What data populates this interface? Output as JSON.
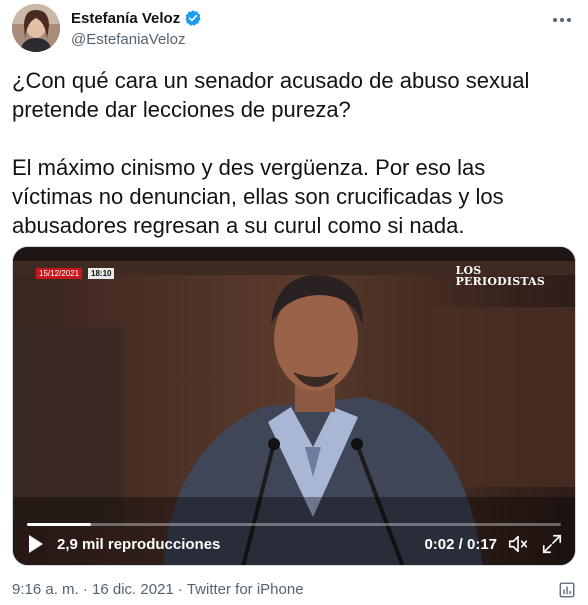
{
  "author": {
    "display_name": "Estefanía Veloz",
    "handle": "@EstefaniaVeloz",
    "avatar_icon": "avatar-photo",
    "verified_icon": "verified-badge-icon"
  },
  "tweet": {
    "text": "¿Con qué cara un senador acusado de abuso sexual\npretende dar lecciones de pureza?\n\nEl máximo cinismo y des vergüenza. Por eso las\nvíctimas no denuncian, ellas son crucificadas y los\nabusadores regresan a su curul como si nada."
  },
  "video": {
    "stamp_date": "15/12/2021",
    "stamp_time": "18:10",
    "logo_line1": "LOS",
    "logo_line2": "PERIODISTAS",
    "views": "2,9 mil reproducciones",
    "time": "0:02 / 0:17",
    "progress": 0.12,
    "buffer": 0.115,
    "accent_color": "#e0245e"
  },
  "footer": {
    "timestamp": "9:16 a. m. · 16 dic. 2021 · Twitter for iPhone"
  },
  "colors": {
    "text": "#0f1419",
    "secondary": "#536471",
    "verified": "#1d9bf0",
    "border": "#cfd9de"
  }
}
